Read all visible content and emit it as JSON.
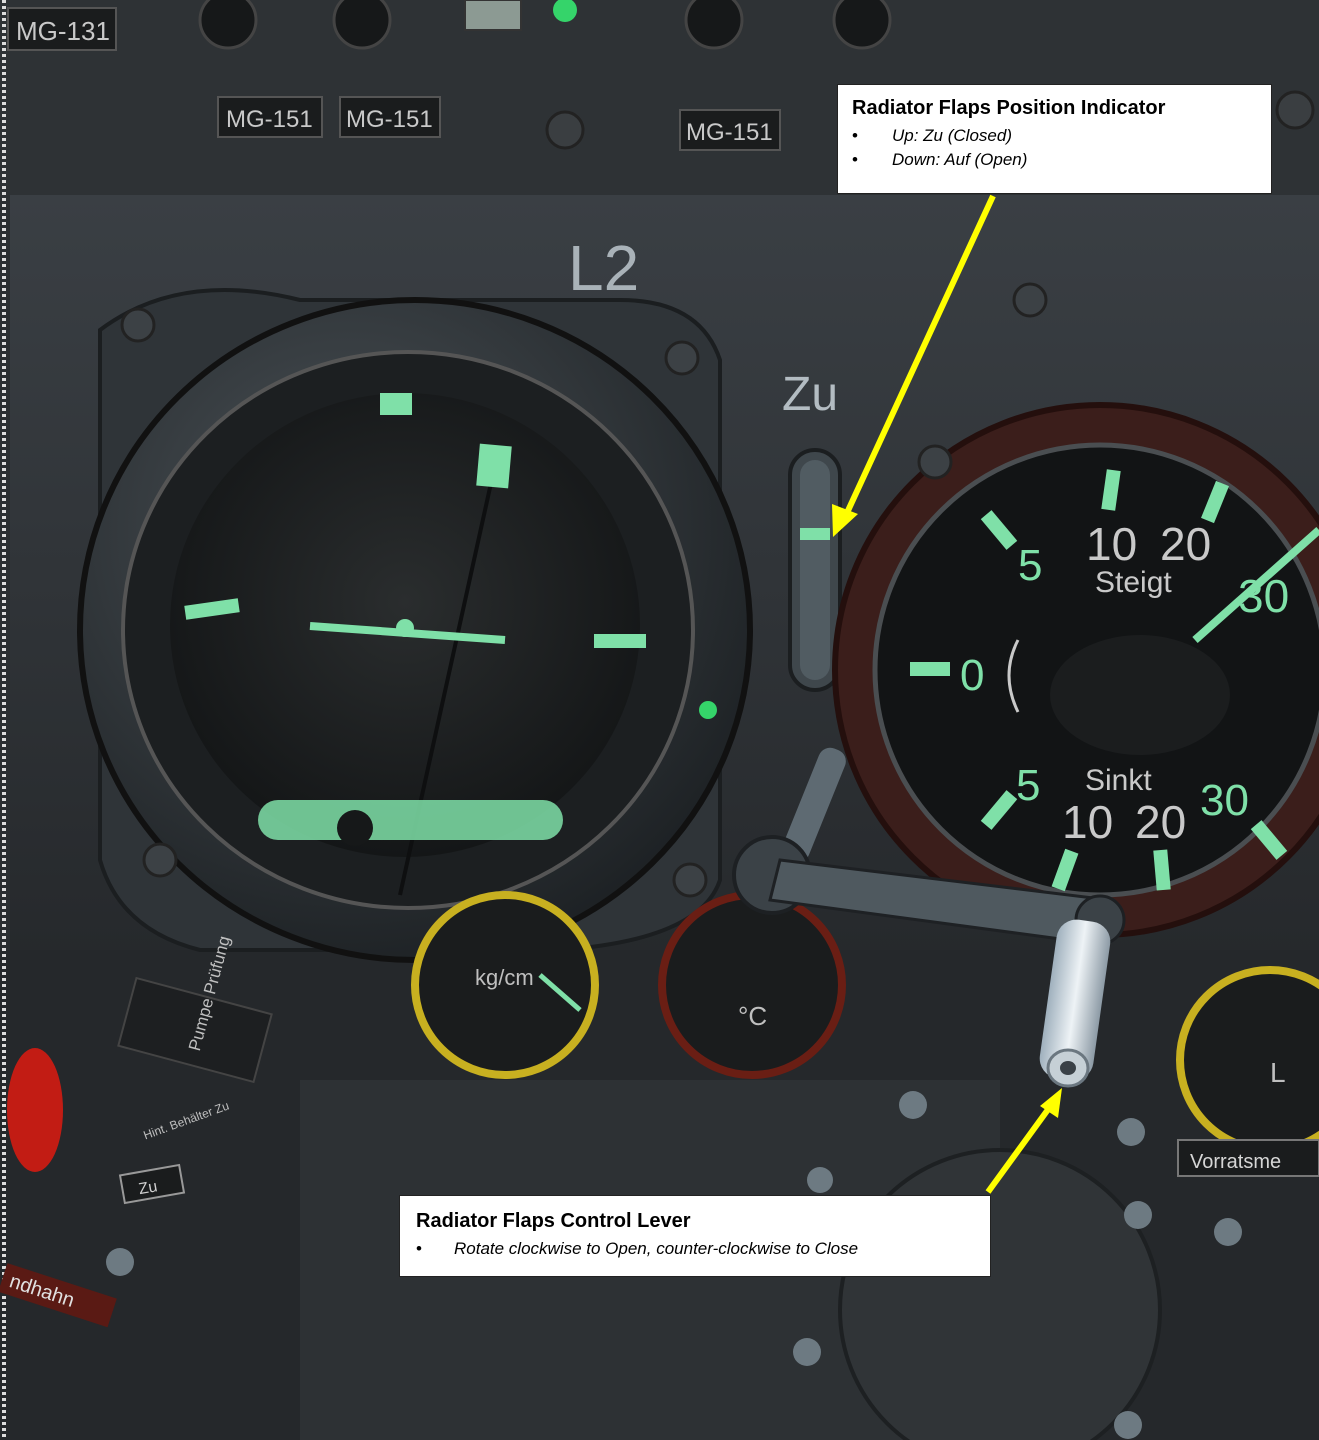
{
  "callouts": {
    "indicator": {
      "title": "Radiator Flaps Position Indicator",
      "items": [
        "Up: Zu (Closed)",
        "Down: Auf (Open)"
      ]
    },
    "lever": {
      "title": "Radiator Flaps Control Lever",
      "items": [
        "Rotate clockwise to Open, counter-clockwise to Close"
      ]
    }
  },
  "panel": {
    "placards": [
      "MG-131",
      "MG-151",
      "MG-151",
      "MG-151"
    ],
    "panel_label": "L2",
    "indicator_top_label": "Zu",
    "vsi": {
      "upper_label": "Steigt",
      "lower_label": "Sinkt",
      "scale_numbers": [
        "5",
        "10",
        "20",
        "30",
        "0",
        "5",
        "10",
        "20",
        "30"
      ]
    },
    "small_gauges": [
      "kg/cm",
      "°C",
      "L"
    ],
    "side_labels": [
      "Pumpe Prüfung",
      "Hint. Behälter Zu",
      "Zu",
      "ndhahn",
      "Vorratsme"
    ]
  },
  "colors": {
    "arrow": "#ffff00",
    "luminous_paint": "#7fe0a8",
    "panel": "#2f3438",
    "callout_bg": "#ffffff"
  }
}
